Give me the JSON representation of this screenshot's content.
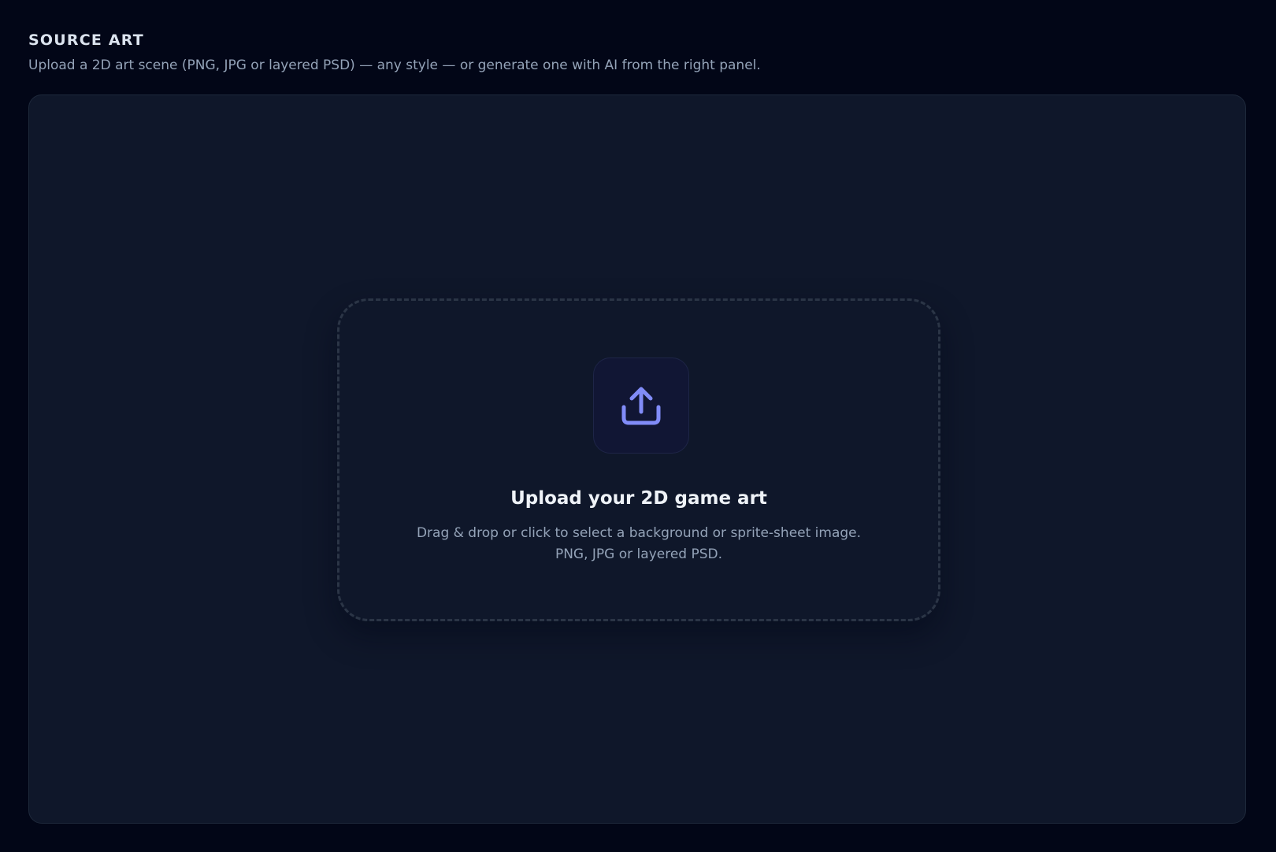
{
  "header": {
    "title": "SOURCE ART",
    "subtitle": "Upload a 2D art scene (PNG, JPG or layered PSD) — any style — or generate one with AI from the right panel."
  },
  "dropzone": {
    "icon": "upload-icon",
    "title": "Upload your 2D game art",
    "hint": "Drag & drop or click to select a background or sprite-sheet image. PNG, JPG or layered PSD."
  },
  "colors": {
    "background": "#020617",
    "panel": "#0f172a",
    "accent": "#818cf8",
    "muted_text": "#94a3b8"
  }
}
